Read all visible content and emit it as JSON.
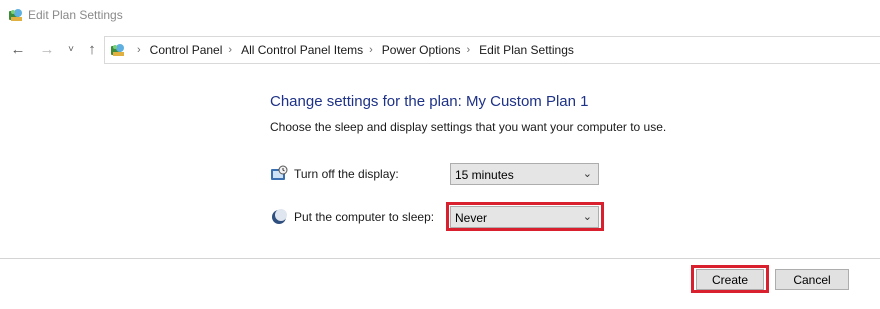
{
  "window": {
    "title": "Edit Plan Settings"
  },
  "navigation": {
    "back_icon": "back-arrow-icon",
    "forward_icon": "forward-arrow-icon",
    "recent_icon": "chevron-down-icon",
    "up_icon": "up-arrow-icon"
  },
  "breadcrumb": {
    "items": [
      "Control Panel",
      "All Control Panel Items",
      "Power Options",
      "Edit Plan Settings"
    ]
  },
  "main": {
    "heading": "Change settings for the plan: My Custom Plan 1",
    "subheading": "Choose the sleep and display settings that you want your computer to use.",
    "display_setting": {
      "label": "Turn off the display:",
      "value": "15 minutes"
    },
    "sleep_setting": {
      "label": "Put the computer to sleep:",
      "value": "Never"
    }
  },
  "footer": {
    "create_label": "Create",
    "cancel_label": "Cancel"
  },
  "colors": {
    "heading": "#1e3287",
    "highlight": "#d9202e"
  }
}
